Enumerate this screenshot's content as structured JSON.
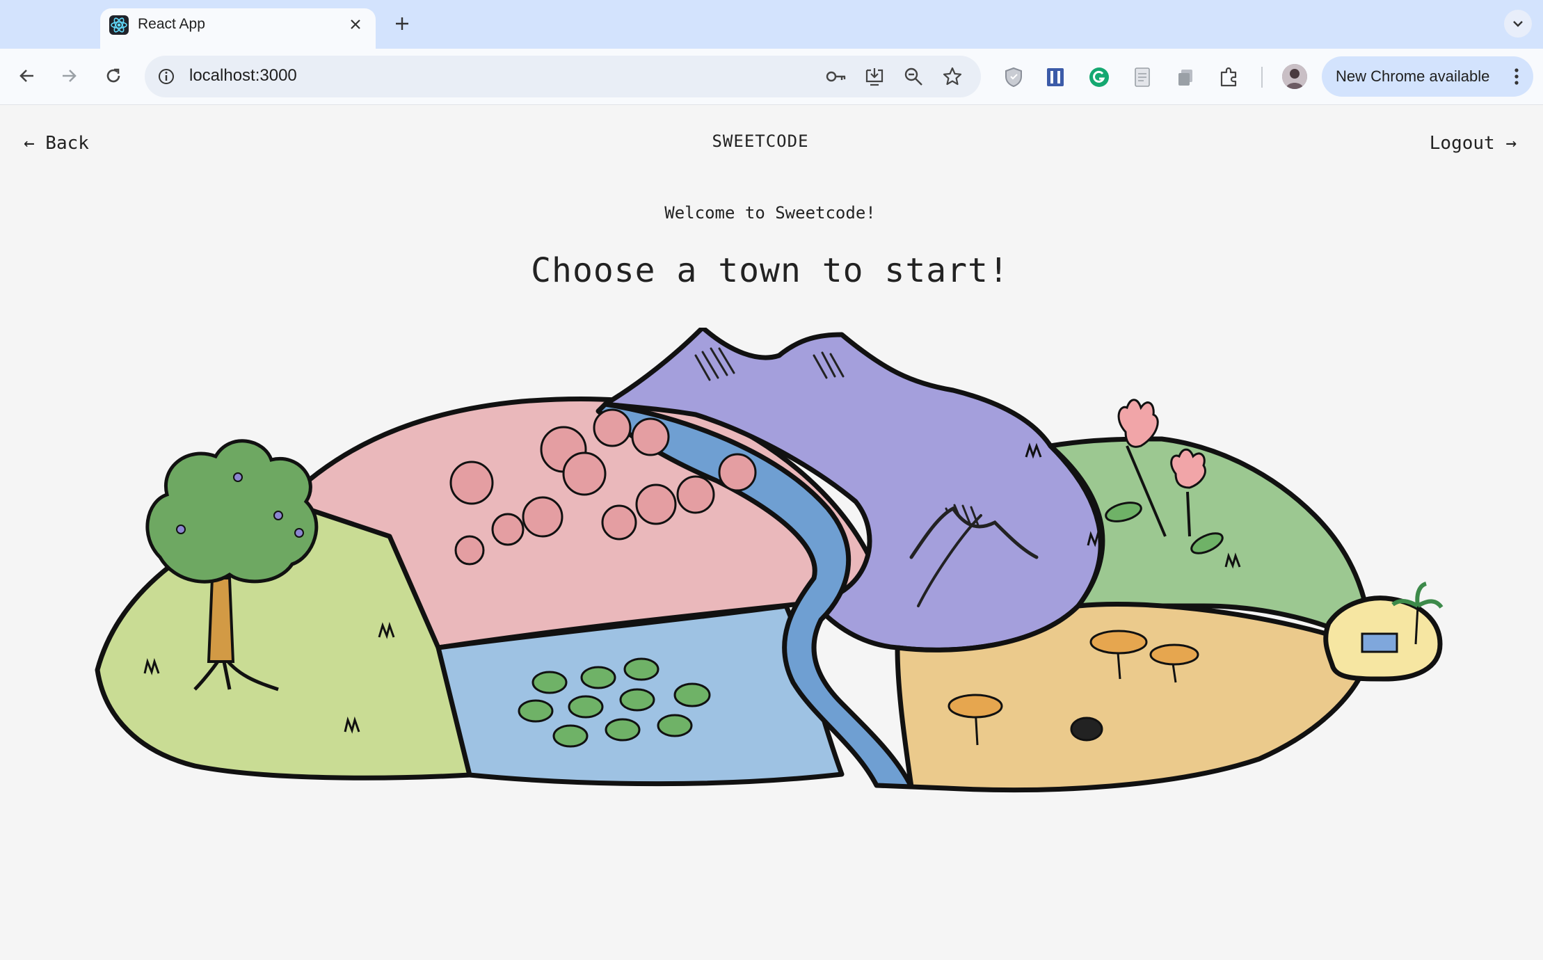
{
  "browser": {
    "tab_title": "React App",
    "url": "localhost:3000",
    "update_label": "New Chrome available"
  },
  "page": {
    "back_label": "← Back",
    "brand": "SWEETCODE",
    "logout_label": "Logout →",
    "welcome": "Welcome to Sweetcode!",
    "headline": "Choose a town to start!"
  },
  "map": {
    "towns": [
      {
        "name": "meadow-town",
        "color": "#c9dc94"
      },
      {
        "name": "orchard-town",
        "color": "#eab8bb"
      },
      {
        "name": "mountain-town",
        "color": "#a49fdc"
      },
      {
        "name": "flower-town",
        "color": "#9cc891"
      },
      {
        "name": "pond-town",
        "color": "#9ec2e3"
      },
      {
        "name": "river",
        "color": "#6f9fd2"
      },
      {
        "name": "savanna-town",
        "color": "#ebca8c"
      },
      {
        "name": "island-town",
        "color": "#f6e6a2"
      }
    ]
  }
}
